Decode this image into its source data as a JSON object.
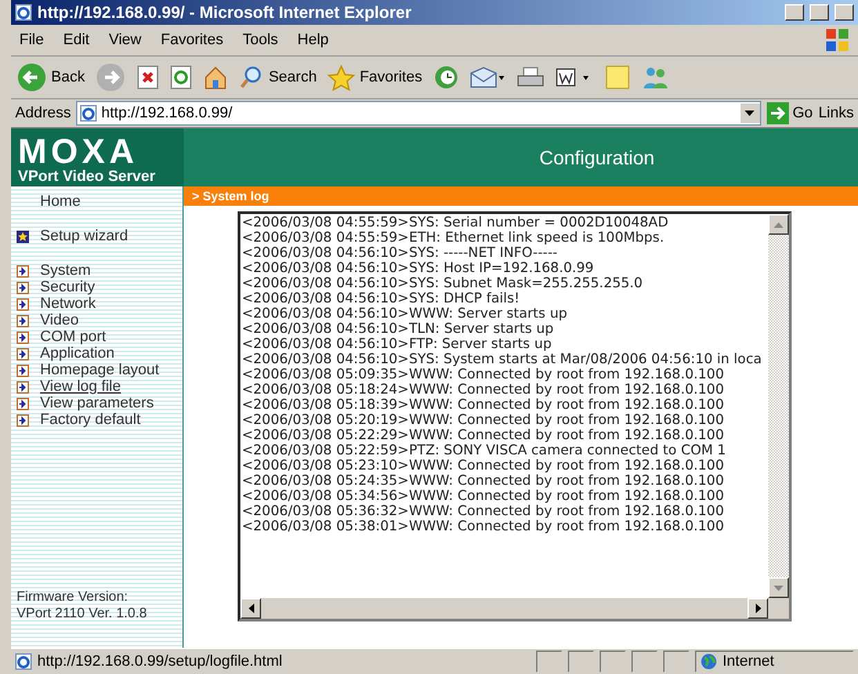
{
  "window": {
    "title": "http://192.168.0.99/ - Microsoft Internet Explorer"
  },
  "menu": [
    "File",
    "Edit",
    "View",
    "Favorites",
    "Tools",
    "Help"
  ],
  "toolbar": [
    {
      "kind": "back",
      "label": "Back"
    },
    {
      "kind": "forward"
    },
    {
      "kind": "stop"
    },
    {
      "kind": "refresh"
    },
    {
      "kind": "home"
    },
    {
      "kind": "search",
      "label": "Search"
    },
    {
      "kind": "favorites",
      "label": "Favorites"
    },
    {
      "kind": "history"
    },
    {
      "kind": "mail"
    },
    {
      "kind": "print"
    },
    {
      "kind": "edit"
    },
    {
      "kind": "note"
    },
    {
      "kind": "messenger"
    }
  ],
  "address": {
    "label": "Address",
    "value": "http://192.168.0.99/",
    "go": "Go",
    "links": "Links"
  },
  "header": {
    "logo": "MOXA",
    "subtitle": "VPort Video Server",
    "title": "Configuration"
  },
  "sidebar": {
    "items": [
      {
        "kind": "plain",
        "label": "Home",
        "selected": false
      },
      {
        "kind": "wizard",
        "label": "Setup wizard",
        "selected": false
      },
      {
        "kind": "link",
        "label": "System",
        "selected": false
      },
      {
        "kind": "link",
        "label": "Security",
        "selected": false
      },
      {
        "kind": "link",
        "label": "Network",
        "selected": false
      },
      {
        "kind": "link",
        "label": "Video",
        "selected": false
      },
      {
        "kind": "link",
        "label": "COM port",
        "selected": false
      },
      {
        "kind": "link",
        "label": "Application",
        "selected": false
      },
      {
        "kind": "link",
        "label": "Homepage layout",
        "selected": false
      },
      {
        "kind": "link",
        "label": "View log file",
        "selected": true
      },
      {
        "kind": "link",
        "label": "View parameters",
        "selected": false
      },
      {
        "kind": "link",
        "label": "Factory default",
        "selected": false
      }
    ],
    "firmware": [
      "Firmware Version:",
      "VPort 2110 Ver. 1.0.8"
    ]
  },
  "breadcrumb": "> System log",
  "log": [
    "<2006/03/08 04:55:59>SYS: Serial number = 0002D10048AD",
    "<2006/03/08 04:55:59>ETH: Ethernet link speed is 100Mbps.",
    "<2006/03/08 04:56:10>SYS: -----NET INFO-----",
    "<2006/03/08 04:56:10>SYS: Host IP=192.168.0.99",
    "<2006/03/08 04:56:10>SYS: Subnet Mask=255.255.255.0",
    "<2006/03/08 04:56:10>SYS: DHCP fails!",
    "<2006/03/08 04:56:10>WWW: Server starts up",
    "<2006/03/08 04:56:10>TLN: Server starts up",
    "<2006/03/08 04:56:10>FTP: Server starts up",
    "<2006/03/08 04:56:10>SYS: System starts at Mar/08/2006 04:56:10 in loca",
    "<2006/03/08 05:09:35>WWW: Connected by root from 192.168.0.100",
    "<2006/03/08 05:18:24>WWW: Connected by root from 192.168.0.100",
    "<2006/03/08 05:18:39>WWW: Connected by root from 192.168.0.100",
    "<2006/03/08 05:20:19>WWW: Connected by root from 192.168.0.100",
    "<2006/03/08 05:22:29>WWW: Connected by root from 192.168.0.100",
    "<2006/03/08 05:22:59>PTZ: SONY VISCA camera connected to COM 1",
    "<2006/03/08 05:23:10>WWW: Connected by root from 192.168.0.100",
    "<2006/03/08 05:24:35>WWW: Connected by root from 192.168.0.100",
    "<2006/03/08 05:34:56>WWW: Connected by root from 192.168.0.100",
    "<2006/03/08 05:36:32>WWW: Connected by root from 192.168.0.100",
    "<2006/03/08 05:38:01>WWW: Connected by root from 192.168.0.100"
  ],
  "status_bar": {
    "url": "http://192.168.0.99/setup/logfile.html",
    "zone": "Internet"
  }
}
